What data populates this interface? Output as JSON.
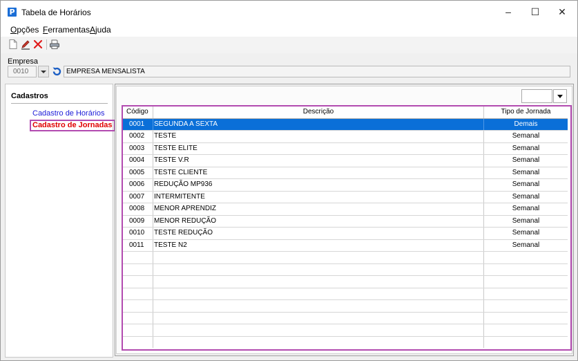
{
  "window": {
    "title": "Tabela de Horários",
    "min": "–",
    "max": "☐",
    "close": "✕"
  },
  "menu": [
    {
      "underline": "O",
      "rest": "pções"
    },
    {
      "underline": "F",
      "rest": "erramentas"
    },
    {
      "underline": "A",
      "rest": "juda"
    }
  ],
  "empresa": {
    "label": "Empresa",
    "code": "0010",
    "name": "EMPRESA MENSALISTA"
  },
  "nav": {
    "title": "Cadastros",
    "items": [
      {
        "label": "Cadastro de Horários"
      },
      {
        "label": "Cadastro de Jornadas"
      }
    ]
  },
  "grid": {
    "headers": {
      "code": "Código",
      "desc": "Descrição",
      "tipo": "Tipo de Jornada"
    },
    "rows": [
      {
        "code": "0001",
        "desc": "SEGUNDA A SEXTA",
        "tipo": "Demais"
      },
      {
        "code": "0002",
        "desc": "TESTE",
        "tipo": "Semanal"
      },
      {
        "code": "0003",
        "desc": "TESTE ELITE",
        "tipo": "Semanal"
      },
      {
        "code": "0004",
        "desc": "TESTE V.R",
        "tipo": "Semanal"
      },
      {
        "code": "0005",
        "desc": "TESTE CLIENTE",
        "tipo": "Semanal"
      },
      {
        "code": "0006",
        "desc": "REDUÇÃO MP936",
        "tipo": "Semanal"
      },
      {
        "code": "0007",
        "desc": "INTERMITENTE",
        "tipo": "Semanal"
      },
      {
        "code": "0008",
        "desc": "MENOR APRENDIZ",
        "tipo": "Semanal"
      },
      {
        "code": "0009",
        "desc": "MENOR REDUÇÃO",
        "tipo": "Semanal"
      },
      {
        "code": "0010",
        "desc": "TESTE REDUÇÃO",
        "tipo": "Semanal"
      },
      {
        "code": "0011",
        "desc": "TESTE N2",
        "tipo": "Semanal"
      }
    ],
    "selected_index": 0
  },
  "colors": {
    "selection": "#0a6fd8",
    "highlight_border": "#b24bb0",
    "active_link": "#e00000",
    "link": "#1c1cd8"
  }
}
